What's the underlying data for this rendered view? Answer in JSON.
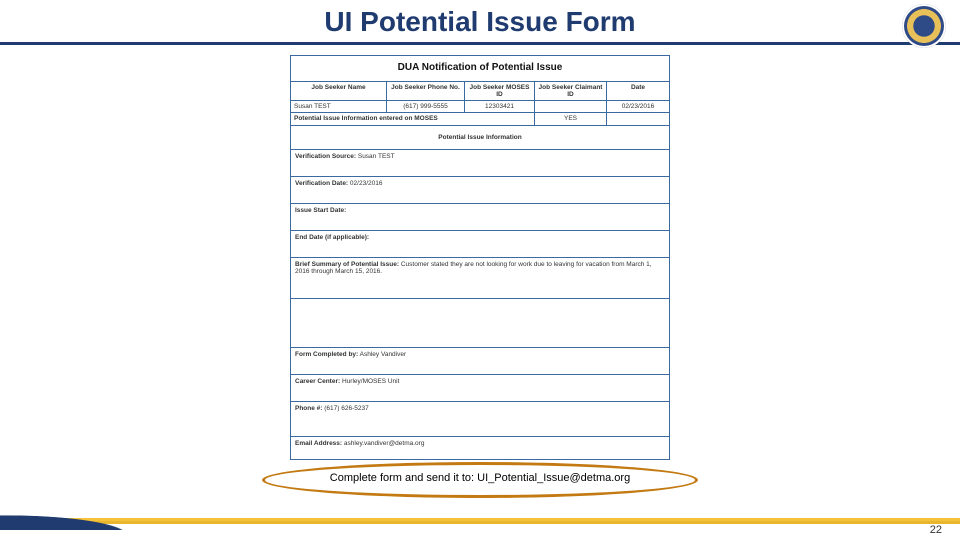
{
  "title": "UI Potential Issue Form",
  "page_number": "22",
  "callout": "Complete form and send it to: UI_Potential_Issue@detma.org",
  "form": {
    "heading": "DUA Notification of Potential Issue",
    "header_labels": {
      "name": "Job Seeker Name",
      "phone": "Job Seeker Phone No.",
      "moses": "Job Seeker MOSES ID",
      "claimant": "Job Seeker Claimant ID",
      "date": "Date"
    },
    "header_values": {
      "name": "Susan TEST",
      "phone": "(617) 999-5555",
      "moses": "12303421",
      "claimant": "",
      "date": "02/23/2016"
    },
    "entered_row": {
      "label": "Potential Issue Information entered on MOSES",
      "value": "YES"
    },
    "section_heading": "Potential Issue Information",
    "rows": {
      "verif_source": {
        "label": "Verification Source:",
        "value": "Susan TEST"
      },
      "verif_date": {
        "label": "Verification Date:",
        "value": "02/23/2016"
      },
      "issue_start": {
        "label": "Issue Start Date:",
        "value": ""
      },
      "end_date": {
        "label": "End Date (if applicable):",
        "value": ""
      },
      "brief": {
        "label": "Brief Summary of Potential Issue:",
        "value": "Customer stated they are not looking for work due to leaving for vacation from March 1, 2016 through March 15, 2016."
      },
      "completed_by": {
        "label": "Form Completed by:",
        "value": "Ashley Vandiver"
      },
      "career_center": {
        "label": "Career Center:",
        "value": "Hurley/MOSES Unit"
      },
      "phone_num": {
        "label": "Phone #:",
        "value": "(617) 626-5237"
      },
      "email": {
        "label": "Email Address:",
        "value": "ashley.vandiver@detma.org"
      }
    }
  }
}
